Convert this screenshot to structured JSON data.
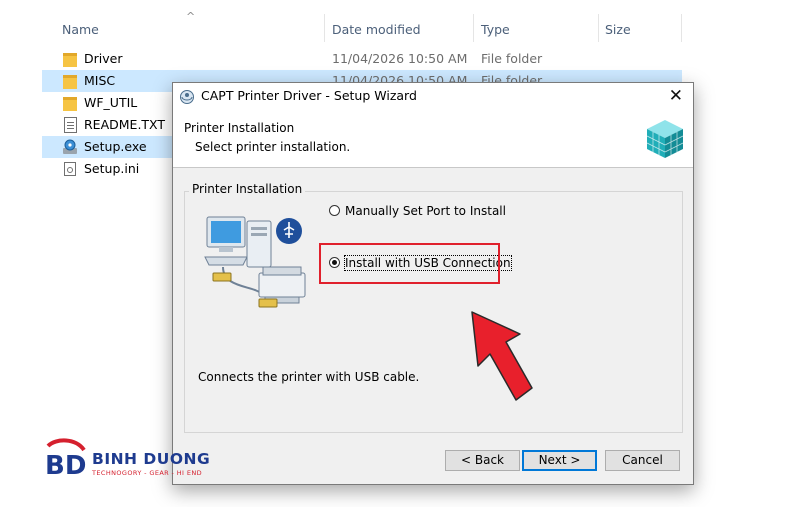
{
  "explorer": {
    "columns": {
      "name": "Name",
      "date": "Date modified",
      "type": "Type",
      "size": "Size"
    },
    "files": [
      {
        "name": "Driver",
        "date": "11/04/2026 10:50 AM",
        "type": "File folder",
        "icon": "folder-icon"
      },
      {
        "name": "MISC",
        "date": "11/04/2026 10:50 AM",
        "type": "File folder",
        "icon": "folder-icon"
      },
      {
        "name": "WF_UTIL",
        "date": "",
        "type": "",
        "icon": "folder-icon"
      },
      {
        "name": "README.TXT",
        "date": "",
        "type": "",
        "icon": "text-file-icon"
      },
      {
        "name": "Setup.exe",
        "date": "",
        "type": "",
        "icon": "setup-exe-icon"
      },
      {
        "name": "Setup.ini",
        "date": "",
        "type": "",
        "icon": "ini-file-icon"
      }
    ]
  },
  "dialog": {
    "title": "CAPT Printer Driver - Setup Wizard",
    "banner_title": "Printer Installation",
    "banner_subtitle": "Select printer installation.",
    "group_label": "Printer Installation",
    "options": [
      {
        "label": "Manually Set Port to Install",
        "selected": false
      },
      {
        "label": "Install with USB Connection",
        "selected": true
      }
    ],
    "description": "Connects the printer with USB cable.",
    "buttons": {
      "back": "< Back",
      "next": "Next >",
      "cancel": "Cancel"
    }
  },
  "watermark": {
    "name": "BINH DUONG",
    "tagline": "TECHNOGORY - GEAR - HI END",
    "monogram": "BD"
  },
  "colors": {
    "highlight": "#e0202c",
    "selection": "#cce8ff",
    "arrow": "#e8202c",
    "default_button": "#0078d7"
  }
}
